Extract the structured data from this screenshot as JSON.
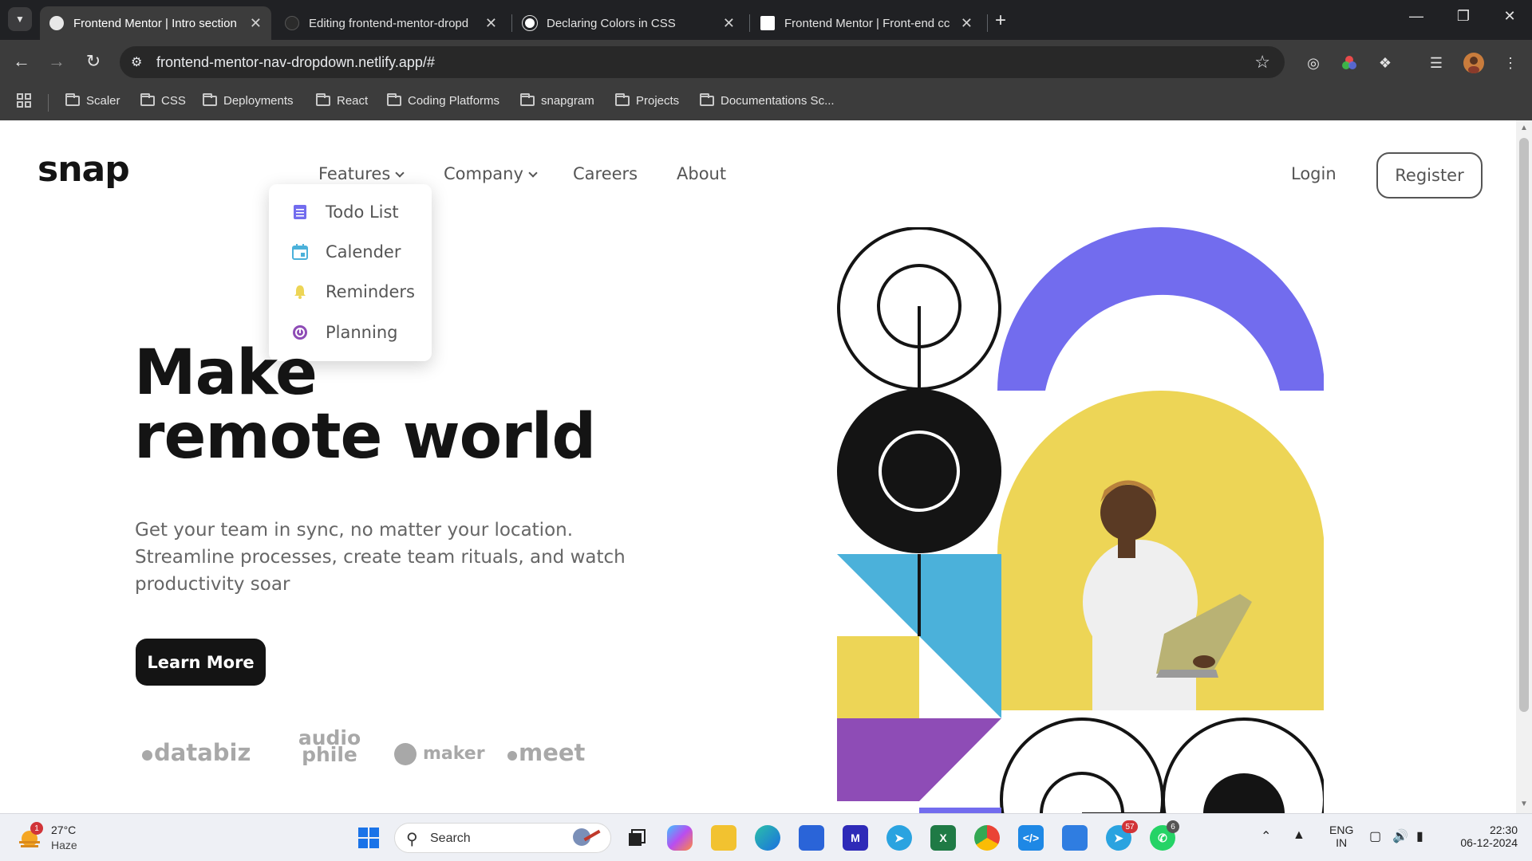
{
  "browser": {
    "tabs": [
      {
        "title": "Frontend Mentor | Intro section",
        "active": true
      },
      {
        "title": "Editing frontend-mentor-dropd",
        "active": false
      },
      {
        "title": "Declaring Colors in CSS",
        "active": false
      },
      {
        "title": "Frontend Mentor | Front-end cc",
        "active": false
      }
    ],
    "url": "frontend-mentor-nav-dropdown.netlify.app/#",
    "bookmarks": [
      "Scaler",
      "CSS",
      "Deployments",
      "React",
      "Coding Platforms",
      "snapgram",
      "Projects",
      "Documentations Sc..."
    ]
  },
  "page": {
    "logo": "snap",
    "nav": {
      "features": "Features",
      "company": "Company",
      "careers": "Careers",
      "about": "About",
      "login": "Login",
      "register": "Register"
    },
    "dropdown": [
      {
        "label": "Todo List",
        "icon": "todo-list-icon",
        "color": "#726CEE"
      },
      {
        "label": "Calender",
        "icon": "calendar-icon",
        "color": "#4BB1DA"
      },
      {
        "label": "Reminders",
        "icon": "bell-icon",
        "color": "#EDD556"
      },
      {
        "label": "Planning",
        "icon": "planning-icon",
        "color": "#8E4CB6"
      }
    ],
    "hero": {
      "title_line1": "Make",
      "title_line2": "remote world",
      "subtitle": "Get your team in sync, no matter your location. Streamline processes, create team rituals, and watch productivity soar",
      "cta": "Learn More"
    },
    "clients": [
      "databiz",
      "audio phile",
      "maker",
      "meet"
    ]
  },
  "taskbar": {
    "weather": {
      "temp": "27°C",
      "desc": "Haze",
      "alerts": "1"
    },
    "search_label": "Search",
    "language": "ENG",
    "region": "IN",
    "time": "22:30",
    "date": "06-12-2024",
    "telegram_badge": "57",
    "whatsapp_badge": "6"
  },
  "colors": {
    "accent_purple": "#726CEE",
    "accent_yellow": "#EDD556",
    "accent_blue": "#4BB1DA",
    "accent_violet": "#8E4CB6",
    "ink": "#141414"
  }
}
